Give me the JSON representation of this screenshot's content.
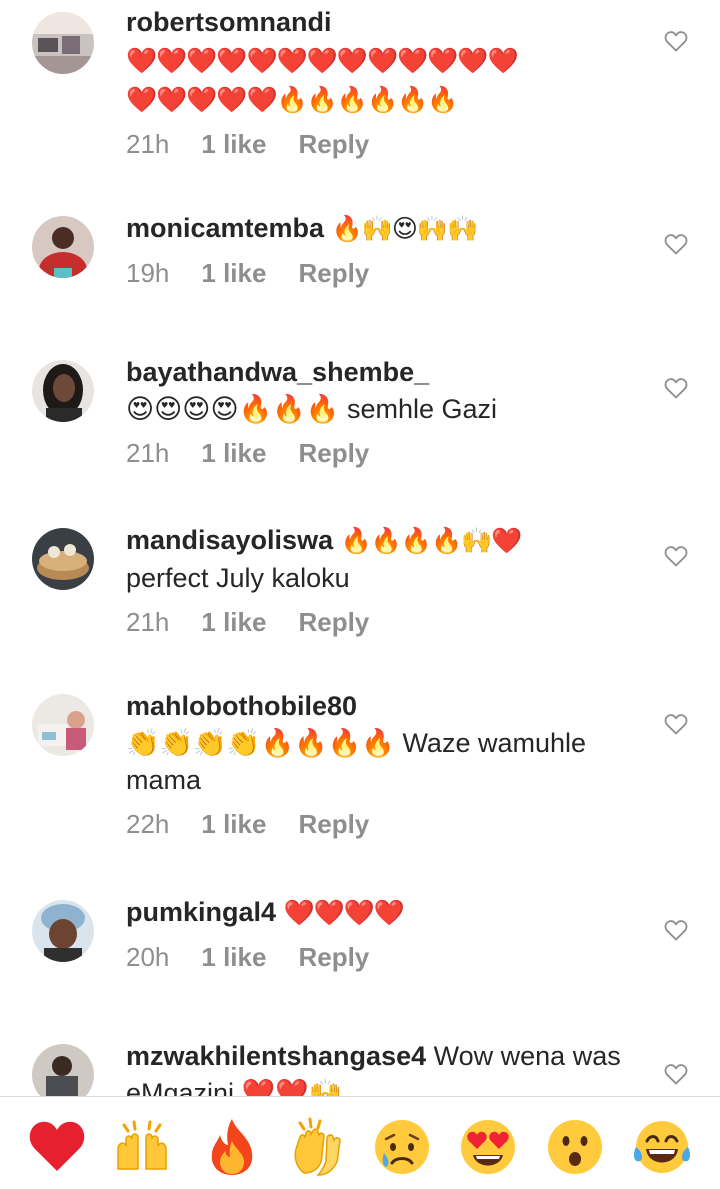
{
  "comments": [
    {
      "username": "robertsomnandi",
      "text_lines": [
        "❤️❤️❤️❤️❤️❤️❤️❤️❤️❤️❤️❤️❤️",
        "❤️❤️❤️❤️❤️🔥🔥🔥🔥🔥🔥"
      ],
      "time": "21h",
      "likes": "1 like",
      "reply": "Reply"
    },
    {
      "username": "monicamtemba",
      "inline_text": "🔥🙌😍🙌🙌",
      "time": "19h",
      "likes": "1 like",
      "reply": "Reply"
    },
    {
      "username": "bayathandwa_shembe_",
      "text_lines": [
        "😍😍😍😍🔥🔥🔥 semhle Gazi"
      ],
      "time": "21h",
      "likes": "1 like",
      "reply": "Reply"
    },
    {
      "username": "mandisayoliswa",
      "inline_text": "🔥🔥🔥🔥🙌❤️",
      "text_lines": [
        "perfect July kaloku"
      ],
      "time": "21h",
      "likes": "1 like",
      "reply": "Reply"
    },
    {
      "username": "mahlobothobile80",
      "text_lines": [
        "👏👏👏👏🔥🔥🔥🔥 Waze wamuhle",
        "mama"
      ],
      "time": "22h",
      "likes": "1 like",
      "reply": "Reply"
    },
    {
      "username": "pumkingal4",
      "inline_text": "❤️❤️❤️❤️",
      "time": "20h",
      "likes": "1 like",
      "reply": "Reply"
    },
    {
      "username": "mzwakhilentshangase4",
      "inline_text": "Wow wena was",
      "text_lines": [
        "eMgazini ❤️❤️🙌"
      ]
    }
  ],
  "reactions": [
    "❤️",
    "🙌",
    "🔥",
    "👏",
    "😢",
    "😍",
    "😮",
    "😂"
  ],
  "icons": {
    "like_button": "heart-outline-icon"
  },
  "colors": {
    "text": "#262626",
    "meta": "#8e8e8e",
    "divider": "#dbdbdb"
  }
}
